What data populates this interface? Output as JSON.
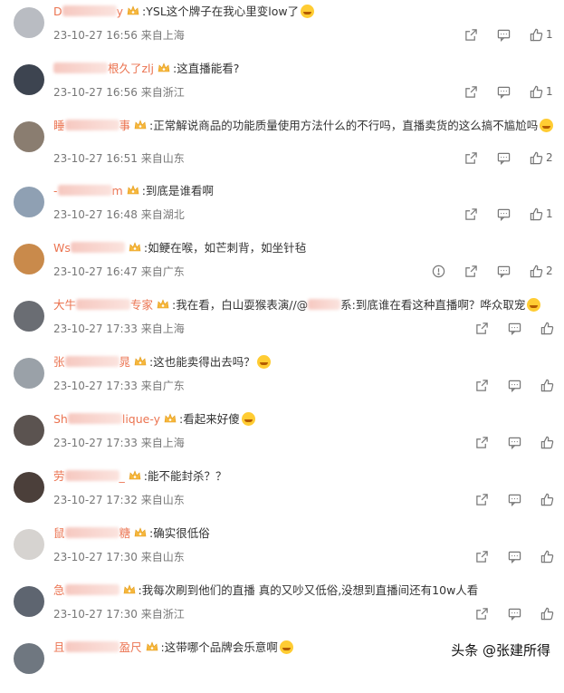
{
  "comments": [
    {
      "user_prefix": "D",
      "user_suffix": "y",
      "text": ":YSL这个牌子在我心里变low了",
      "emoji": true,
      "time": "23-10-27 16:56",
      "loc": "来自上海",
      "likes": "1",
      "actions": [
        "share",
        "comment",
        "like"
      ]
    },
    {
      "user_prefix": "",
      "user_suffix": "根久了zlj",
      "text": ":这直播能看?",
      "emoji": false,
      "time": "23-10-27 16:56",
      "loc": "来自浙江",
      "likes": "1",
      "actions": [
        "share",
        "comment",
        "like"
      ]
    },
    {
      "user_prefix": "睡",
      "user_suffix": "事",
      "text": ":正常解说商品的功能质量使用方法什么的不行吗，直播卖货的这么搞不尴尬吗",
      "emoji": true,
      "time": "23-10-27 16:51",
      "loc": "来自山东",
      "likes": "2",
      "actions": [
        "share",
        "comment",
        "like"
      ]
    },
    {
      "user_prefix": "-",
      "user_suffix": "m",
      "text": ":到底是谁看啊",
      "emoji": false,
      "time": "23-10-27 16:48",
      "loc": "来自湖北",
      "likes": "1",
      "actions": [
        "share",
        "comment",
        "like"
      ]
    },
    {
      "user_prefix": "Ws",
      "user_suffix": "",
      "text": ":如鲠在喉，如芒刺背，如坐针毡",
      "emoji": false,
      "time": "23-10-27 16:47",
      "loc": "来自广东",
      "likes": "2",
      "actions": [
        "report",
        "share",
        "comment",
        "like"
      ]
    },
    {
      "user_prefix": "大牛",
      "user_suffix": "专家",
      "text": ":我在看，白山耍猴表演//@",
      "text2": "系:到底谁在看这种直播啊？哗众取宠",
      "emoji": true,
      "time": "23-10-27 17:33",
      "loc": "来自上海",
      "likes": "",
      "actions": [
        "share",
        "comment",
        "like"
      ]
    },
    {
      "user_prefix": "张",
      "user_suffix": "晁",
      "text": ":这也能卖得出去吗？",
      "emoji": true,
      "time": "23-10-27 17:33",
      "loc": "来自广东",
      "likes": "",
      "actions": [
        "share",
        "comment",
        "like"
      ]
    },
    {
      "user_prefix": "Sh",
      "user_suffix": "lique-y",
      "text": ":看起来好傻",
      "emoji": true,
      "time": "23-10-27 17:33",
      "loc": "来自上海",
      "likes": "",
      "actions": [
        "share",
        "comment",
        "like"
      ]
    },
    {
      "user_prefix": "劳",
      "user_suffix": "_",
      "text": ":能不能封杀？？",
      "emoji": false,
      "time": "23-10-27 17:32",
      "loc": "来自山东",
      "likes": "",
      "actions": [
        "share",
        "comment",
        "like"
      ]
    },
    {
      "user_prefix": "鼠",
      "user_suffix": "糖",
      "text": ":确实很低俗",
      "emoji": false,
      "time": "23-10-27 17:30",
      "loc": "来自山东",
      "likes": "",
      "actions": [
        "share",
        "comment",
        "like"
      ]
    },
    {
      "user_prefix": "急",
      "user_suffix": "",
      "text": ":我每次刷到他们的直播 真的又吵又低俗,没想到直播间还有10w人看",
      "emoji": false,
      "time": "23-10-27 17:30",
      "loc": "来自浙江",
      "likes": "",
      "actions": [
        "share",
        "comment",
        "like"
      ]
    },
    {
      "user_prefix": "且",
      "user_suffix": "盈尺",
      "text": ":这带哪个品牌会乐意啊",
      "emoji": true,
      "time": "",
      "loc": "",
      "likes": "",
      "actions": []
    }
  ],
  "watermark": "头条 @张建所得",
  "colors": {
    "username": "#eb7350",
    "meta": "#777777",
    "text": "#333333"
  }
}
